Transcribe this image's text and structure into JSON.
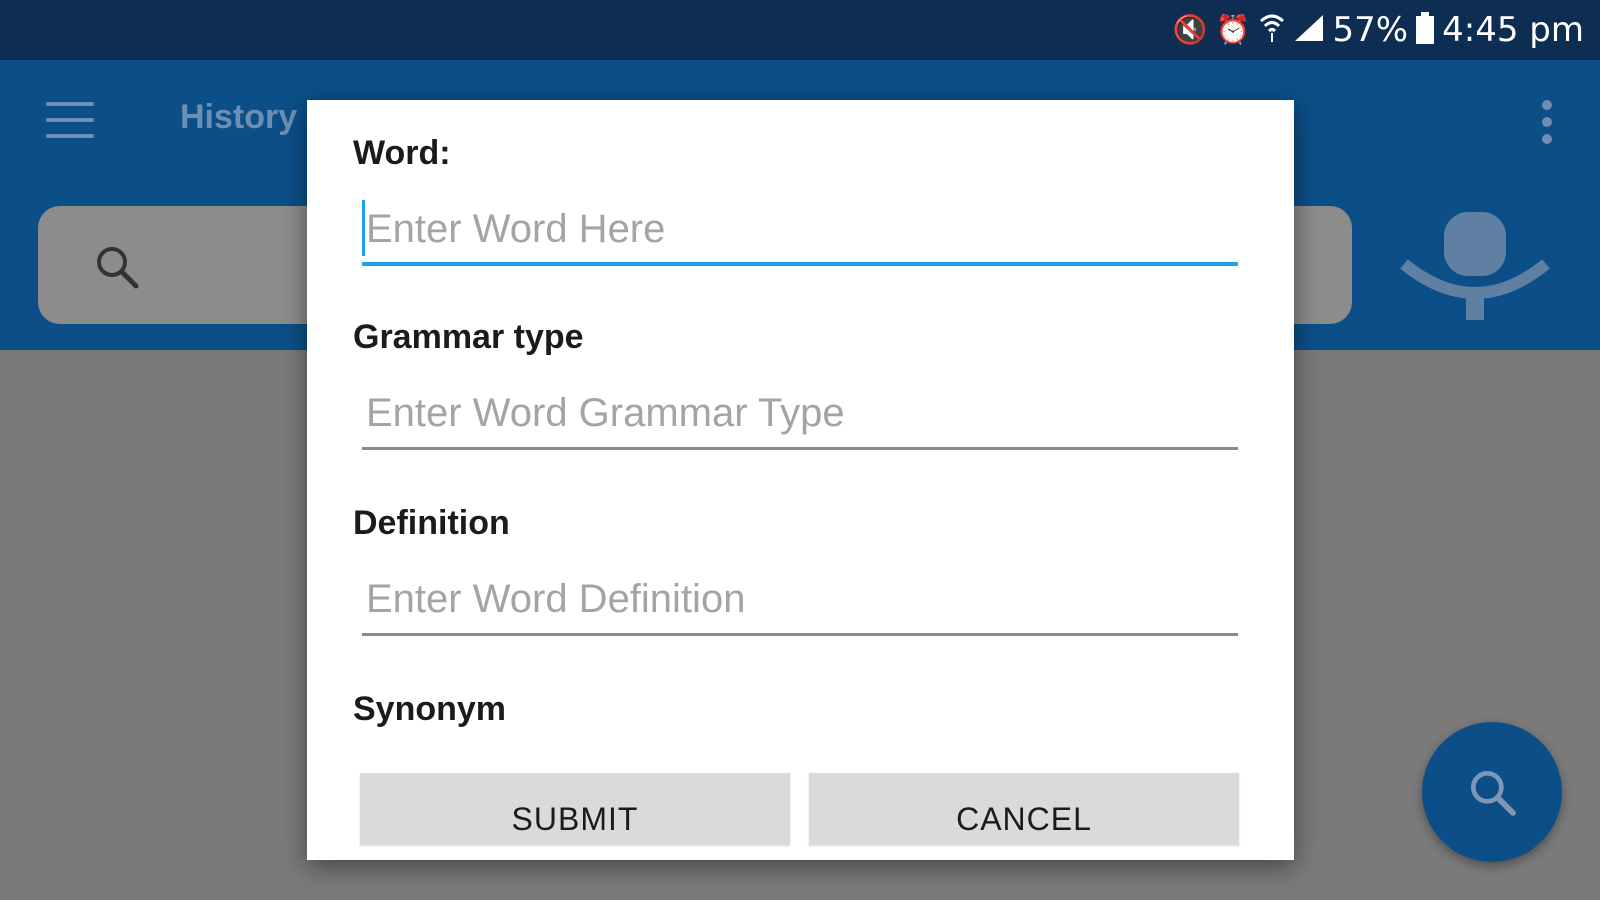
{
  "status_bar": {
    "battery_percent": "57%",
    "time": "4:45 pm",
    "icons": [
      "mute-icon",
      "alarm-icon",
      "wifi-icon",
      "signal-icon",
      "battery-icon"
    ]
  },
  "app_bar": {
    "title": "History",
    "icons": [
      "hamburger-icon",
      "more-vert-icon"
    ]
  },
  "search": {
    "icons": [
      "search-icon",
      "mic-icon"
    ]
  },
  "dialog": {
    "word_label": "Word:",
    "word_placeholder": "Enter Word Here",
    "grammar_label": "Grammar type",
    "grammar_placeholder": "Enter Word Grammar Type",
    "definition_label": "Definition",
    "definition_placeholder": "Enter Word Definition",
    "synonym_label": "Synonym",
    "submit_label": "SUBMIT",
    "cancel_label": "CANCEL"
  },
  "colors": {
    "status_bar": "#0d2d52",
    "app_bar": "#0c4f88",
    "accent_focus": "#1da1e8",
    "scrim": "#7a7a7a"
  }
}
